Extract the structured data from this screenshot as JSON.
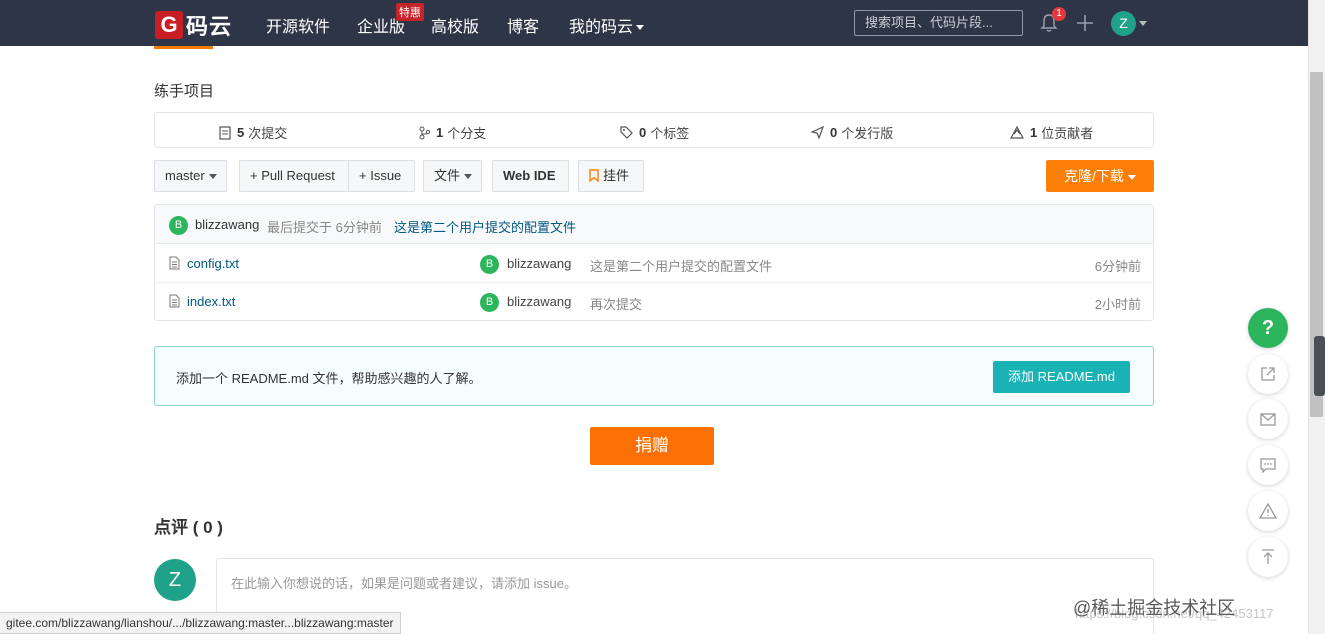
{
  "nav": {
    "logo_letter": "G",
    "logo_text": "码云",
    "items": [
      "开源软件",
      "企业版",
      "高校版",
      "博客",
      "我的码云"
    ],
    "enterprise_badge": "特惠",
    "search_placeholder": "搜索项目、代码片段...",
    "notification_count": "1",
    "user_initial": "Z"
  },
  "project": {
    "description": "练手项目"
  },
  "stats": [
    {
      "count": "5",
      "label": "次提交",
      "icon": "commit-icon"
    },
    {
      "count": "1",
      "label": "个分支",
      "icon": "branch-icon"
    },
    {
      "count": "0",
      "label": "个标签",
      "icon": "tag-icon"
    },
    {
      "count": "0",
      "label": "个发行版",
      "icon": "release-icon"
    },
    {
      "count": "1",
      "label": "位贡献者",
      "icon": "contributors-icon"
    }
  ],
  "toolbar": {
    "branch": "master",
    "pull_request": "+ Pull Request",
    "issue": "+ Issue",
    "files": "文件",
    "web_ide": "Web IDE",
    "widget": "挂件",
    "clone": "克隆/下载"
  },
  "last_commit": {
    "avatar": "B",
    "author": "blizzawang",
    "meta": "最后提交于 6分钟前",
    "message": "这是第二个用户提交的配置文件"
  },
  "files": [
    {
      "name": "config.txt",
      "avatar": "B",
      "author": "blizzawang",
      "message": "这是第二个用户提交的配置文件",
      "time": "6分钟前"
    },
    {
      "name": "index.txt",
      "avatar": "B",
      "author": "blizzawang",
      "message": "再次提交",
      "time": "2小时前"
    }
  ],
  "readme_notice": {
    "text": "添加一个 README.md 文件，帮助感兴趣的人了解。",
    "button": "添加 README.md"
  },
  "donate_label": "捐赠",
  "comments": {
    "title": "点评 ( 0 )",
    "avatar": "Z",
    "placeholder": "在此输入你想说的话，如果是问题或者建议，请添加 issue。"
  },
  "float_help": "?",
  "status_url": "gitee.com/blizzawang/lianshou/.../blizzawang:master...blizzawang:master",
  "watermark": "@稀土掘金技术社区",
  "watermark_url": "https://blog.csdn.net/qq_42453117",
  "colors": {
    "nav_bg": "#2e3546",
    "accent_orange": "#fb7f06",
    "avatar_green": "#2db55d",
    "readme_teal": "#19b3b6"
  }
}
